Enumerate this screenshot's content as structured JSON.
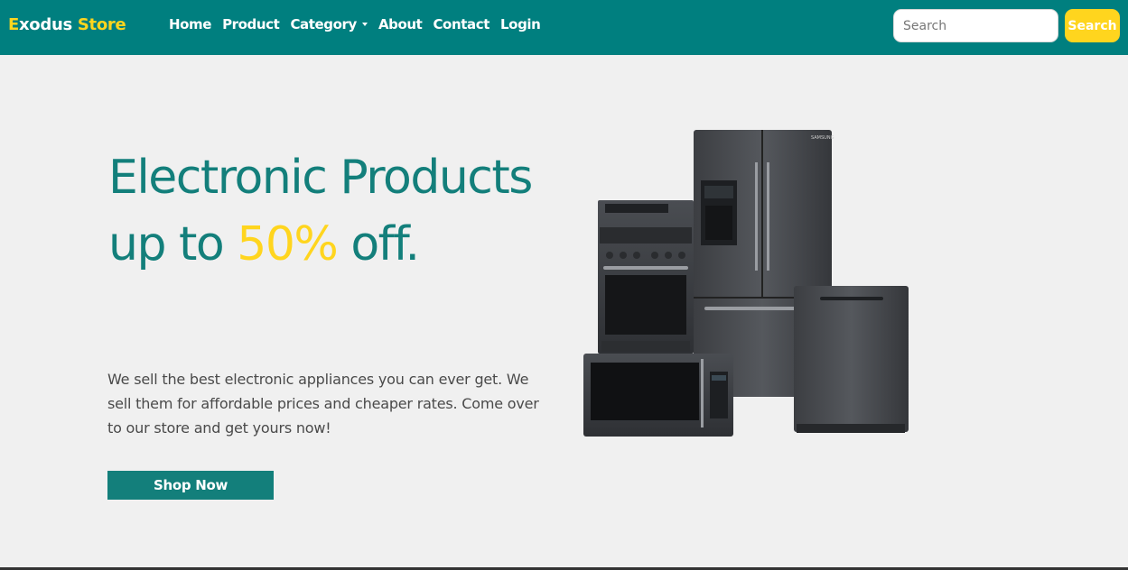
{
  "brand": {
    "part1": "E",
    "part2": "xodus ",
    "part3": "Store"
  },
  "nav": {
    "home": "Home",
    "product": "Product",
    "category": "Category",
    "about": "About",
    "contact": "Contact",
    "login": "Login"
  },
  "search": {
    "placeholder": "Search",
    "value": "",
    "button_label": "Search"
  },
  "hero": {
    "headline_line1": "Electronic Products",
    "headline_line2_prefix": "up to ",
    "headline_highlight": "50%",
    "headline_line2_suffix": " off.",
    "description": "We sell the best electronic appliances you can ever get. We sell them for affordable prices and cheaper rates. Come over to our store and get yours now!",
    "cta_label": "Shop Now",
    "image_alt": "kitchen-appliances-image",
    "image_brand_label": "SAMSUNG"
  },
  "colors": {
    "navbar": "#007f7f",
    "accent_yellow": "#ffd51e",
    "teal_text": "#137f7b",
    "page_bg": "#f0f0f0"
  }
}
